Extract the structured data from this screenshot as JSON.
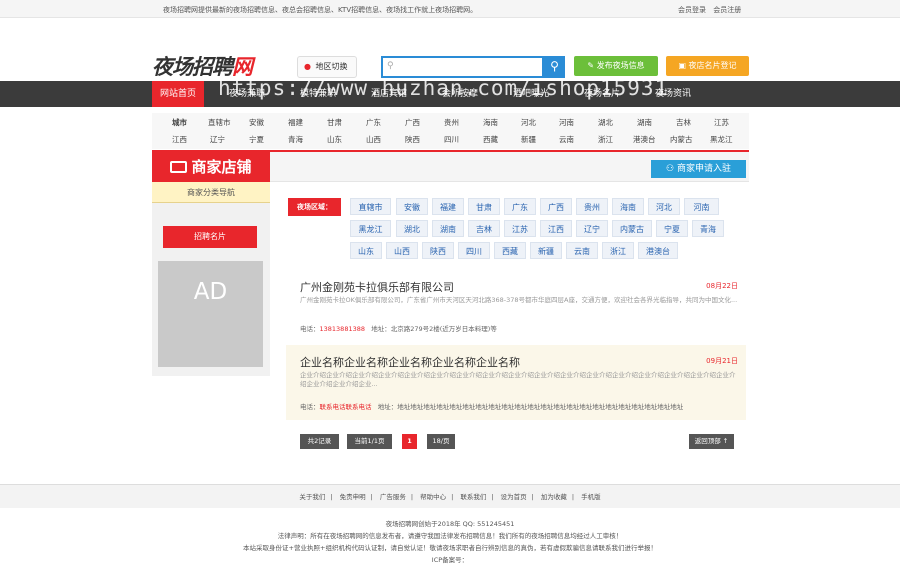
{
  "topbar": {
    "notice": "夜场招聘网提供最新的夜场招聘信息、夜总会招聘信息、KTV招聘信息、夜场找工作就上夜场招聘网。",
    "login": "会员登录",
    "register": "会员注册"
  },
  "header": {
    "logo_text": "夜场招聘",
    "logo_accent": "网",
    "region_switch": "地区切换",
    "search_placeholder": "",
    "publish_button": "发布夜场信息",
    "shop_button": "夜店名片登记"
  },
  "nav": {
    "items": [
      "网站首页",
      "夜场兼职",
      "模特兼职",
      "酒店宾馆",
      "会所按摩",
      "酒吧曝光",
      "夜场名片",
      "夜场资讯"
    ],
    "watermark": "https://www.huzhan.com/ishop15931"
  },
  "cities": {
    "row1": [
      "城市",
      "直辖市",
      "安徽",
      "福建",
      "甘肃",
      "广东",
      "广西",
      "贵州",
      "海南",
      "河北",
      "河南",
      "湖北",
      "湖南",
      "吉林",
      "江苏"
    ],
    "row2": [
      "江西",
      "辽宁",
      "宁夏",
      "青海",
      "山东",
      "山西",
      "陕西",
      "四川",
      "西藏",
      "新疆",
      "云南",
      "浙江",
      "港澳台",
      "内蒙古",
      "黑龙江"
    ]
  },
  "sidebar": {
    "title": "商家店铺",
    "category_nav": "商家分类导航",
    "card_tag": "招聘名片",
    "ad": "AD"
  },
  "main": {
    "apply_button": "商家申请入驻",
    "region_label": "夜场区域：",
    "regions_row1": [
      "直辖市",
      "安徽",
      "福建",
      "甘肃",
      "广东",
      "广西",
      "贵州",
      "海南",
      "河北",
      "河南"
    ],
    "regions_row2": [
      "黑龙江",
      "湖北",
      "湖南",
      "吉林",
      "江苏",
      "江西",
      "辽宁",
      "内蒙古",
      "宁夏",
      "青海"
    ],
    "regions_row3": [
      "山东",
      "山西",
      "陕西",
      "四川",
      "西藏",
      "新疆",
      "云南",
      "浙江",
      "港澳台"
    ]
  },
  "listings": [
    {
      "title": "广州金刚苑卡拉俱乐部有限公司",
      "date": "08月22日",
      "desc": "广州金刚苑卡拉OK俱乐部有限公司，广东省广州市天河区天河北路368-378号都市华庭四层A座，交通方便，欢迎社会各界光临指导，共同为中国文化...",
      "phone_label": "电话：",
      "phone": "13813881388",
      "address_label": "地址：",
      "address": "北京路279号2楼(近万岁日本料理)等"
    },
    {
      "title": "企业名称企业名称企业名称企业名称企业名称",
      "date": "09月21日",
      "desc": "企业介绍企业介绍企业介绍企业介绍企业介绍企业介绍企业介绍企业介绍企业介绍企业介绍企业介绍企业介绍企业介绍企业介绍企业介绍企业介绍企业介绍企业介绍企业介绍企业...",
      "phone_label": "电话：",
      "phone": "联系电话联系电话",
      "address_label": "地址：",
      "address": "地址地址地址地址地址地址地址地址地址地址地址地址地址地址地址地址地址地址地址地址地址地址"
    }
  ],
  "pager": {
    "total": "共2记录",
    "current": "当前1/1页",
    "page": "1",
    "per_page": "18/页",
    "back_top": "返回顶部 ↑"
  },
  "footer": {
    "links": [
      "关于我们",
      "免责申明",
      "广告服务",
      "帮助中心",
      "联系我们",
      "设为首页",
      "加为收藏",
      "手机版"
    ],
    "line1": "夜场招聘网创始于2018年 QQ: 551245451",
    "line2": "法律声明：所有在夜场招聘网的信息发布者，请遵守我国法律发布招聘信息！我们所有的夜场招聘信息均经过人工审核！",
    "line3": "本站采取身份证+营业执照+组织机构代码认证制，请自觉认证！敬请夜场求职者自行辨别信息的真伪，若有虚假欺骗信息请联系我们进行举报！",
    "line4": "ICP备案号："
  },
  "colors": {
    "brand_red": "#e8262c",
    "search_blue": "#2a8cd6",
    "publish_green": "#6cbf3a",
    "shop_orange": "#f5a623"
  }
}
